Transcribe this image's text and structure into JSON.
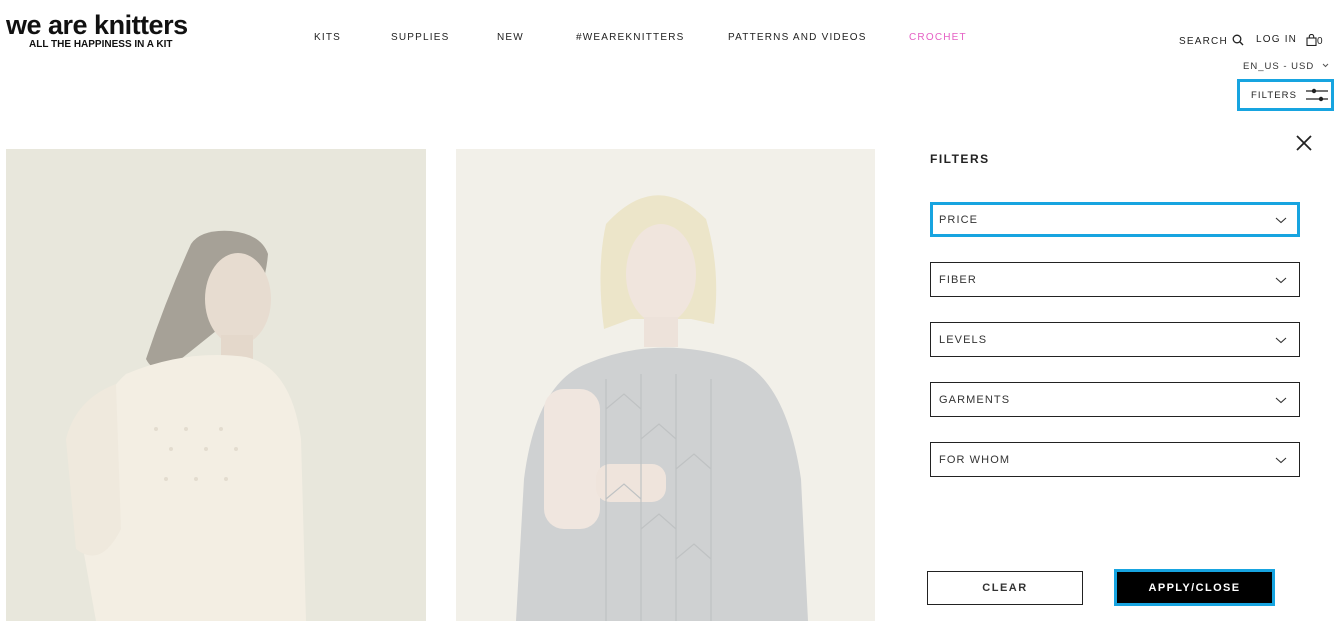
{
  "brand": {
    "name": "we are knitters",
    "tagline": "ALL THE HAPPINESS IN A KIT"
  },
  "nav": {
    "items": [
      {
        "label": "KITS"
      },
      {
        "label": "SUPPLIES"
      },
      {
        "label": "NEW"
      },
      {
        "label": "#WEAREKNITTERS"
      },
      {
        "label": "PATTERNS AND VIDEOS"
      },
      {
        "label": "CROCHET",
        "color": "#e55fc4"
      }
    ]
  },
  "header": {
    "search_label": "SEARCH",
    "login_label": "LOG IN",
    "cart_count": "0",
    "locale": "EN_US - USD",
    "filters_label": "FILTERS"
  },
  "products": [
    {
      "image": "woman-cream-knit-sweater"
    },
    {
      "image": "woman-grey-lace-knit-sweater"
    }
  ],
  "filter_panel": {
    "title": "FILTERS",
    "dropdowns": [
      {
        "label": "PRICE"
      },
      {
        "label": "FIBER"
      },
      {
        "label": "LEVELS"
      },
      {
        "label": "GARMENTS"
      },
      {
        "label": "FOR WHOM"
      }
    ],
    "clear_label": "CLEAR",
    "apply_label": "APPLY/CLOSE"
  },
  "colors": {
    "highlight": "#17a4e0",
    "accent": "#e55fc4"
  }
}
